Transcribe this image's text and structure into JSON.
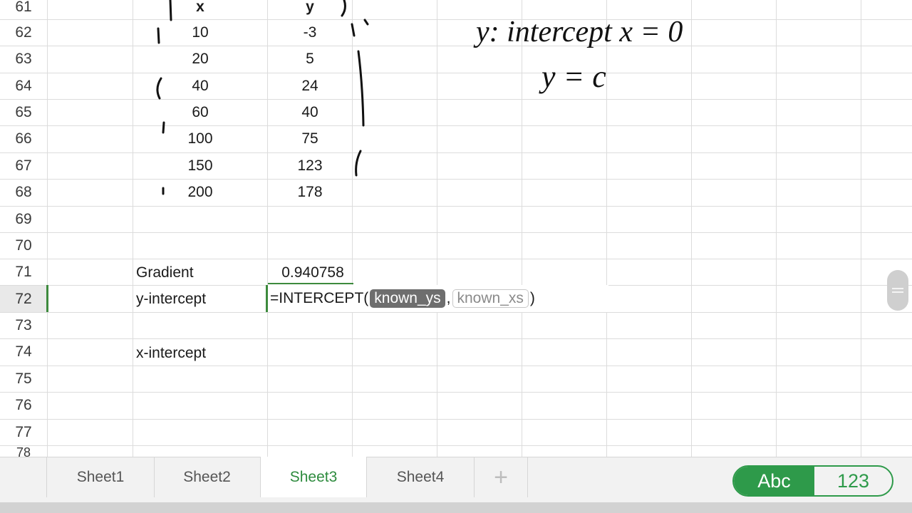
{
  "rows": [
    {
      "num": "61",
      "x": "x",
      "y": "y"
    },
    {
      "num": "62",
      "x": "10",
      "y": "-3"
    },
    {
      "num": "63",
      "x": "20",
      "y": "5"
    },
    {
      "num": "64",
      "x": "40",
      "y": "24"
    },
    {
      "num": "65",
      "x": "60",
      "y": "40"
    },
    {
      "num": "66",
      "x": "100",
      "y": "75"
    },
    {
      "num": "67",
      "x": "150",
      "y": "123"
    },
    {
      "num": "68",
      "x": "200",
      "y": "178"
    },
    {
      "num": "69",
      "x": "",
      "y": ""
    },
    {
      "num": "70",
      "x": "",
      "y": ""
    },
    {
      "num": "71",
      "x": "Gradient",
      "y": "0.940758"
    },
    {
      "num": "72",
      "x": "y-intercept",
      "y": ""
    },
    {
      "num": "73",
      "x": "",
      "y": ""
    },
    {
      "num": "74",
      "x": "x-intercept",
      "y": ""
    },
    {
      "num": "75",
      "x": "",
      "y": ""
    },
    {
      "num": "76",
      "x": "",
      "y": ""
    },
    {
      "num": "77",
      "x": "",
      "y": ""
    }
  ],
  "formula": {
    "prefix": "=INTERCEPT(",
    "arg1": "known_ys",
    "separator": ",",
    "arg2": "known_xs",
    "suffix": ")"
  },
  "annotations": {
    "line1": "y: intercept  x = 0",
    "line2": "y = c"
  },
  "tabs": [
    "Sheet1",
    "Sheet2",
    "Sheet3",
    "Sheet4"
  ],
  "active_tab": "Sheet3",
  "add_tab_icon": "plus-icon",
  "keyboard_toggle": {
    "abc": "Abc",
    "num": "123"
  },
  "colors": {
    "accent": "#2e9a4a",
    "token_active": "#6e6e6e"
  }
}
